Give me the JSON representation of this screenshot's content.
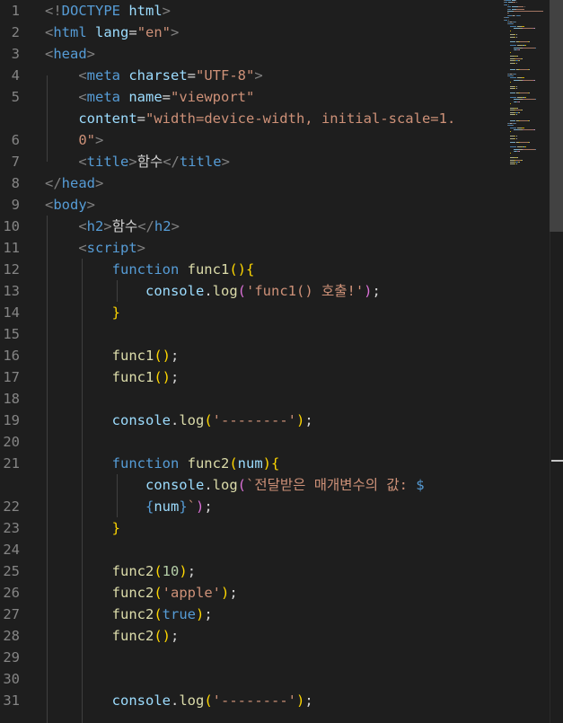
{
  "gutter": {
    "numbers": [
      "1",
      "2",
      "3",
      "4",
      "5",
      "",
      "6",
      "7",
      "8",
      "9",
      "10",
      "11",
      "12",
      "13",
      "14",
      "15",
      "16",
      "17",
      "18",
      "19",
      "20",
      "21",
      "",
      "22",
      "23",
      "24",
      "25",
      "26",
      "27",
      "28",
      "29",
      "30",
      "31"
    ]
  },
  "code": {
    "lines": [
      [
        {
          "t": "<!",
          "c": "br"
        },
        {
          "t": "DOCTYPE",
          "c": "tag"
        },
        {
          "t": " html",
          "c": "attr"
        },
        {
          "t": ">",
          "c": "br"
        }
      ],
      [
        {
          "t": "<",
          "c": "br"
        },
        {
          "t": "html",
          "c": "tag"
        },
        {
          "t": " lang",
          "c": "attr"
        },
        {
          "t": "=",
          "c": "txt"
        },
        {
          "t": "\"en\"",
          "c": "str"
        },
        {
          "t": ">",
          "c": "br"
        }
      ],
      [
        {
          "t": "<",
          "c": "br"
        },
        {
          "t": "head",
          "c": "tag"
        },
        {
          "t": ">",
          "c": "br"
        }
      ],
      [
        {
          "t": "    <",
          "c": "br"
        },
        {
          "t": "meta",
          "c": "tag"
        },
        {
          "t": " charset",
          "c": "attr"
        },
        {
          "t": "=",
          "c": "txt"
        },
        {
          "t": "\"UTF-8\"",
          "c": "str"
        },
        {
          "t": ">",
          "c": "br"
        }
      ],
      [
        {
          "t": "    <",
          "c": "br"
        },
        {
          "t": "meta",
          "c": "tag"
        },
        {
          "t": " name",
          "c": "attr"
        },
        {
          "t": "=",
          "c": "txt"
        },
        {
          "t": "\"viewport\"",
          "c": "str"
        }
      ],
      [
        {
          "t": "    content",
          "c": "attr"
        },
        {
          "t": "=",
          "c": "txt"
        },
        {
          "t": "\"width=device-width, initial-scale=1.",
          "c": "str"
        }
      ],
      [
        {
          "t": "    0\"",
          "c": "str"
        },
        {
          "t": ">",
          "c": "br"
        }
      ],
      [
        {
          "t": "    <",
          "c": "br"
        },
        {
          "t": "title",
          "c": "tag"
        },
        {
          "t": ">",
          "c": "br"
        },
        {
          "t": "함수",
          "c": "txt"
        },
        {
          "t": "</",
          "c": "br"
        },
        {
          "t": "title",
          "c": "tag"
        },
        {
          "t": ">",
          "c": "br"
        }
      ],
      [
        {
          "t": "</",
          "c": "br"
        },
        {
          "t": "head",
          "c": "tag"
        },
        {
          "t": ">",
          "c": "br"
        }
      ],
      [
        {
          "t": "<",
          "c": "br"
        },
        {
          "t": "body",
          "c": "tag"
        },
        {
          "t": ">",
          "c": "br"
        }
      ],
      [
        {
          "t": "    <",
          "c": "br"
        },
        {
          "t": "h2",
          "c": "tag"
        },
        {
          "t": ">",
          "c": "br"
        },
        {
          "t": "함수",
          "c": "txt"
        },
        {
          "t": "</",
          "c": "br"
        },
        {
          "t": "h2",
          "c": "tag"
        },
        {
          "t": ">",
          "c": "br"
        }
      ],
      [
        {
          "t": "    <",
          "c": "br"
        },
        {
          "t": "script",
          "c": "tag"
        },
        {
          "t": ">",
          "c": "br"
        }
      ],
      [
        {
          "t": "        function",
          "c": "kw"
        },
        {
          "t": " func1",
          "c": "fn"
        },
        {
          "t": "()",
          "c": "p1"
        },
        {
          "t": "{",
          "c": "p1"
        }
      ],
      [
        {
          "t": "            console",
          "c": "var"
        },
        {
          "t": ".",
          "c": "txt"
        },
        {
          "t": "log",
          "c": "fn"
        },
        {
          "t": "(",
          "c": "p2"
        },
        {
          "t": "'func1() 호출!'",
          "c": "str"
        },
        {
          "t": ")",
          "c": "p2"
        },
        {
          "t": ";",
          "c": "txt"
        }
      ],
      [
        {
          "t": "        }",
          "c": "p1"
        }
      ],
      [],
      [
        {
          "t": "        func1",
          "c": "fn"
        },
        {
          "t": "()",
          "c": "p1"
        },
        {
          "t": ";",
          "c": "txt"
        }
      ],
      [
        {
          "t": "        func1",
          "c": "fn"
        },
        {
          "t": "()",
          "c": "p1"
        },
        {
          "t": ";",
          "c": "txt"
        }
      ],
      [],
      [
        {
          "t": "        console",
          "c": "var"
        },
        {
          "t": ".",
          "c": "txt"
        },
        {
          "t": "log",
          "c": "fn"
        },
        {
          "t": "(",
          "c": "p1"
        },
        {
          "t": "'--------'",
          "c": "str"
        },
        {
          "t": ")",
          "c": "p1"
        },
        {
          "t": ";",
          "c": "txt"
        }
      ],
      [],
      [
        {
          "t": "        function",
          "c": "kw"
        },
        {
          "t": " func2",
          "c": "fn"
        },
        {
          "t": "(",
          "c": "p1"
        },
        {
          "t": "num",
          "c": "var"
        },
        {
          "t": ")",
          "c": "p1"
        },
        {
          "t": "{",
          "c": "p1"
        }
      ],
      [
        {
          "t": "            console",
          "c": "var"
        },
        {
          "t": ".",
          "c": "txt"
        },
        {
          "t": "log",
          "c": "fn"
        },
        {
          "t": "(",
          "c": "p2"
        },
        {
          "t": "`전달받은 매개변수의 값: ",
          "c": "str"
        },
        {
          "t": "$",
          "c": "tpl"
        }
      ],
      [
        {
          "t": "            {",
          "c": "tpl"
        },
        {
          "t": "num",
          "c": "var"
        },
        {
          "t": "}",
          "c": "tpl"
        },
        {
          "t": "`",
          "c": "str"
        },
        {
          "t": ")",
          "c": "p2"
        },
        {
          "t": ";",
          "c": "txt"
        }
      ],
      [
        {
          "t": "        }",
          "c": "p1"
        }
      ],
      [],
      [
        {
          "t": "        func2",
          "c": "fn"
        },
        {
          "t": "(",
          "c": "p1"
        },
        {
          "t": "10",
          "c": "num"
        },
        {
          "t": ")",
          "c": "p1"
        },
        {
          "t": ";",
          "c": "txt"
        }
      ],
      [
        {
          "t": "        func2",
          "c": "fn"
        },
        {
          "t": "(",
          "c": "p1"
        },
        {
          "t": "'apple'",
          "c": "str"
        },
        {
          "t": ")",
          "c": "p1"
        },
        {
          "t": ";",
          "c": "txt"
        }
      ],
      [
        {
          "t": "        func2",
          "c": "fn"
        },
        {
          "t": "(",
          "c": "p1"
        },
        {
          "t": "true",
          "c": "kw"
        },
        {
          "t": ")",
          "c": "p1"
        },
        {
          "t": ";",
          "c": "txt"
        }
      ],
      [
        {
          "t": "        func2",
          "c": "fn"
        },
        {
          "t": "()",
          "c": "p1"
        },
        {
          "t": ";",
          "c": "txt"
        }
      ],
      [],
      [],
      [
        {
          "t": "        console",
          "c": "var"
        },
        {
          "t": ".",
          "c": "txt"
        },
        {
          "t": "log",
          "c": "fn"
        },
        {
          "t": "(",
          "c": "p1"
        },
        {
          "t": "'--------'",
          "c": "str"
        },
        {
          "t": ")",
          "c": "p1"
        },
        {
          "t": ";",
          "c": "txt"
        }
      ],
      []
    ]
  },
  "colors": {
    "background": "#1e1e1e",
    "line_number": "#858585",
    "tag": "#569cd6",
    "attribute": "#9cdcfe",
    "string": "#ce9178",
    "function": "#dcdcaa",
    "bracket_gold": "#ffd700",
    "bracket_purple": "#da70d6"
  }
}
